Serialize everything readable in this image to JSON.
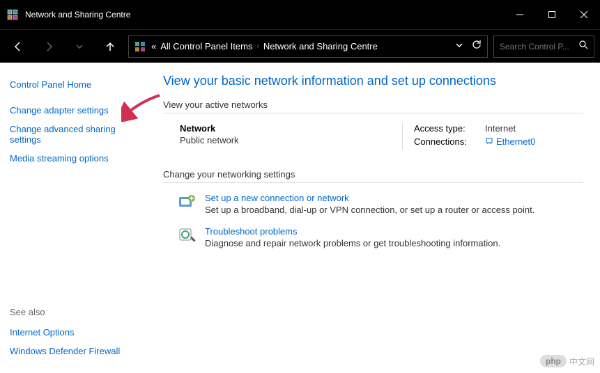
{
  "window": {
    "title": "Network and Sharing Centre"
  },
  "address_bar": {
    "prefix": "«",
    "crumb1": "All Control Panel Items",
    "crumb2": "Network and Sharing Centre"
  },
  "search": {
    "placeholder": "Search Control P..."
  },
  "sidebar": {
    "home": "Control Panel Home",
    "adapter": "Change adapter settings",
    "advanced": "Change advanced sharing settings",
    "media": "Media streaming options",
    "see_also_label": "See also",
    "internet_options": "Internet Options",
    "firewall": "Windows Defender Firewall"
  },
  "main": {
    "title": "View your basic network information and set up connections",
    "active_networks_header": "View your active networks",
    "network": {
      "name": "Network",
      "type": "Public network",
      "access_label": "Access type:",
      "access_value": "Internet",
      "conn_label": "Connections:",
      "conn_value": "Ethernet0"
    },
    "change_header": "Change your networking settings",
    "setup": {
      "title": "Set up a new connection or network",
      "desc": "Set up a broadband, dial-up or VPN connection, or set up a router or access point."
    },
    "troubleshoot": {
      "title": "Troubleshoot problems",
      "desc": "Diagnose and repair network problems or get troubleshooting information."
    }
  },
  "watermark": {
    "badge": "php",
    "text": "中文网"
  }
}
